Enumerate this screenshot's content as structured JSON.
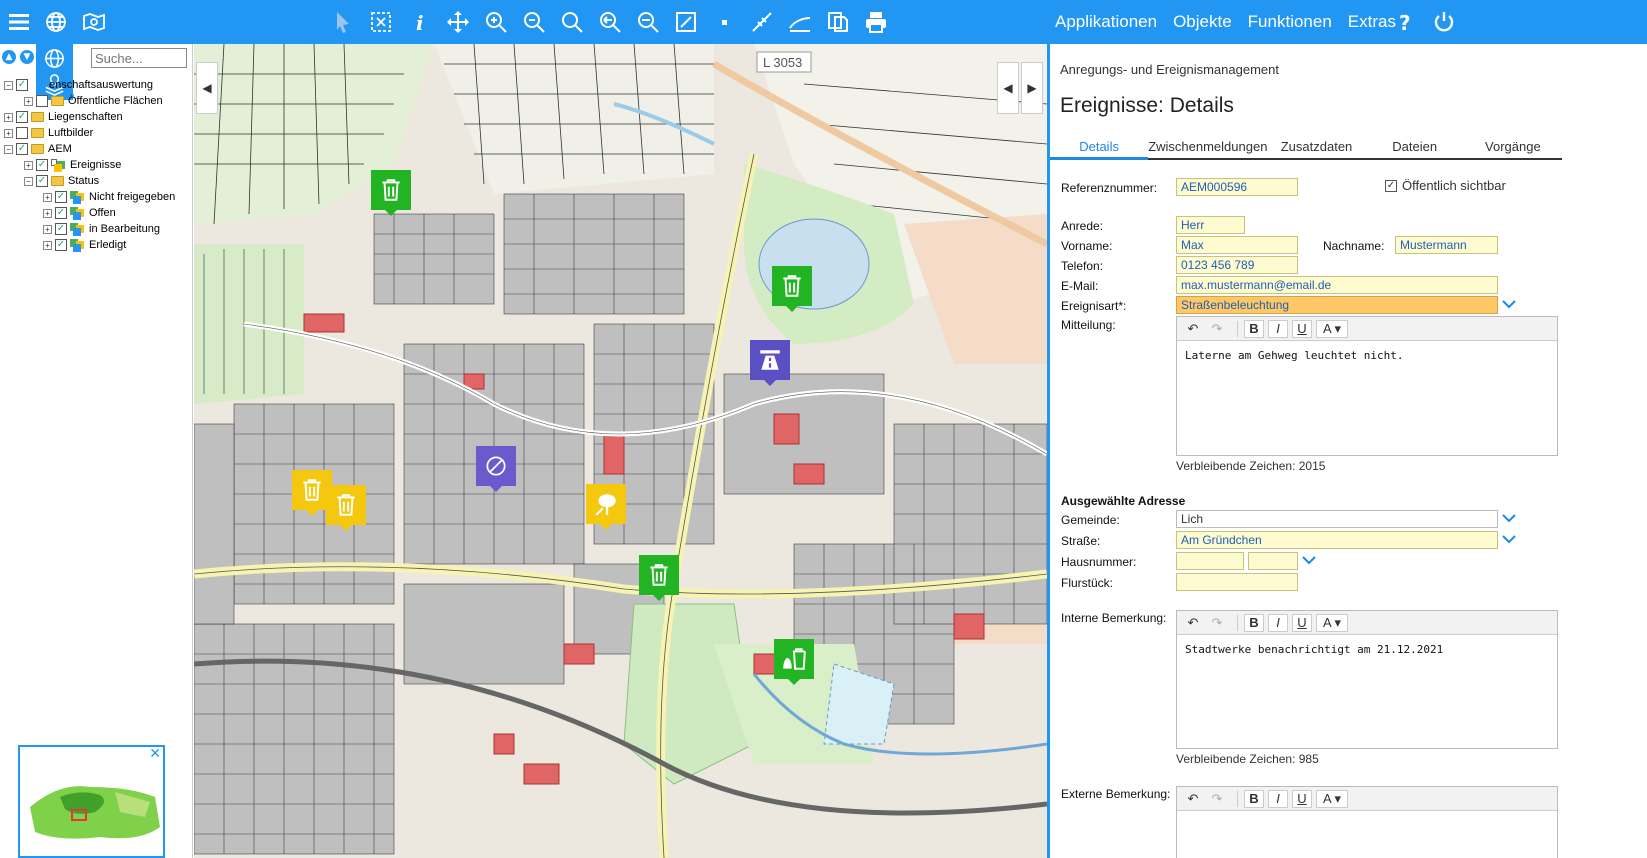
{
  "toolbar": {
    "menu": [
      "Applikationen",
      "Objekte",
      "Funktionen",
      "Extras"
    ],
    "icons": [
      "hamburger-icon",
      "globe-icon",
      "map-book-icon",
      "pointer-icon",
      "select-box-icon",
      "info-icon",
      "pan-icon",
      "zoom-in-icon",
      "zoom-out-icon",
      "zoom-icon",
      "zoom-prev-icon",
      "zoom-next-icon",
      "zoom-extent-icon",
      "point-icon",
      "measure-line-icon",
      "measure-area-icon",
      "copy-icon",
      "print-icon",
      "help-icon",
      "power-icon"
    ]
  },
  "left": {
    "search_placeholder": "Suche...",
    "tree": [
      {
        "label": "enschaftsauswertung",
        "level": 0,
        "checked": true,
        "expanded": true
      },
      {
        "label": "Öffentliche Flächen",
        "level": 1,
        "checked": false,
        "expanded": false
      },
      {
        "label": "Liegenschaften",
        "level": 0,
        "checked": true,
        "expanded": false
      },
      {
        "label": "Luftbilder",
        "level": 0,
        "checked": false,
        "expanded": false
      },
      {
        "label": "AEM",
        "level": 0,
        "checked": true,
        "expanded": true
      },
      {
        "label": "Ereignisse",
        "level": 1,
        "checked": true,
        "expanded": false
      },
      {
        "label": "Status",
        "level": 1,
        "checked": true,
        "expanded": true
      },
      {
        "label": "Nicht freigegeben",
        "level": 2,
        "checked": true,
        "expanded": false
      },
      {
        "label": "Offen",
        "level": 2,
        "checked": true,
        "expanded": false
      },
      {
        "label": "in Bearbeitung",
        "level": 2,
        "checked": true,
        "expanded": false
      },
      {
        "label": "Erledigt",
        "level": 2,
        "checked": true,
        "expanded": false
      }
    ]
  },
  "map": {
    "road_label": "L 3053",
    "markers": [
      {
        "icon": "waste-bin-icon",
        "color": "#22b422"
      },
      {
        "icon": "waste-bin-icon",
        "color": "#22b422"
      },
      {
        "icon": "road-icon",
        "color": "#5b4fc4"
      },
      {
        "icon": "street-lamp-icon",
        "color": "#6a5acd"
      },
      {
        "icon": "waste-bin-icon",
        "color": "#f3c80f"
      },
      {
        "icon": "waste-bin-icon",
        "color": "#f3c80f"
      },
      {
        "icon": "tree-icon",
        "color": "#f3c80f"
      },
      {
        "icon": "waste-bin-icon",
        "color": "#22b422"
      },
      {
        "icon": "waste-bin-bag-icon",
        "color": "#22b422"
      }
    ]
  },
  "panel": {
    "subtitle": "Anregungs- und Ereignismanagement",
    "title": "Ereignisse: Details",
    "tabs": [
      "Details",
      "Zwischenmeldungen",
      "Zusatzdaten",
      "Dateien",
      "Vorgänge"
    ],
    "ref_label": "Referenznummer:",
    "ref_value": "AEM000596",
    "public_label": "Öffentlich sichtbar",
    "anrede_label": "Anrede:",
    "anrede_value": "Herr",
    "vorname_label": "Vorname:",
    "vorname_value": "Max",
    "nachname_label": "Nachname:",
    "nachname_value": "Mustermann",
    "telefon_label": "Telefon:",
    "telefon_value": "0123 456 789",
    "email_label": "E-Mail:",
    "email_value": "max.mustermann@email.de",
    "art_label": "Ereignisart*:",
    "art_value": "Straßenbeleuchtung",
    "mitteilung_label": "Mitteilung:",
    "mitteilung_text": "Laterne am Gehweg leuchtet nicht.",
    "remaining1": "Verbleibende Zeichen: 2015",
    "address_heading": "Ausgewählte Adresse",
    "gemeinde_label": "Gemeinde:",
    "gemeinde_value": "Lich",
    "strasse_label": "Straße:",
    "strasse_value": "Am Gründchen",
    "hausnummer_label": "Hausnummer:",
    "flurstueck_label": "Flurstück:",
    "intern_label": "Interne Bemerkung:",
    "intern_text": "Stadtwerke benachrichtigt am 21.12.2021",
    "remaining2": "Verbleibende Zeichen: 985",
    "extern_label": "Externe Bemerkung:"
  }
}
